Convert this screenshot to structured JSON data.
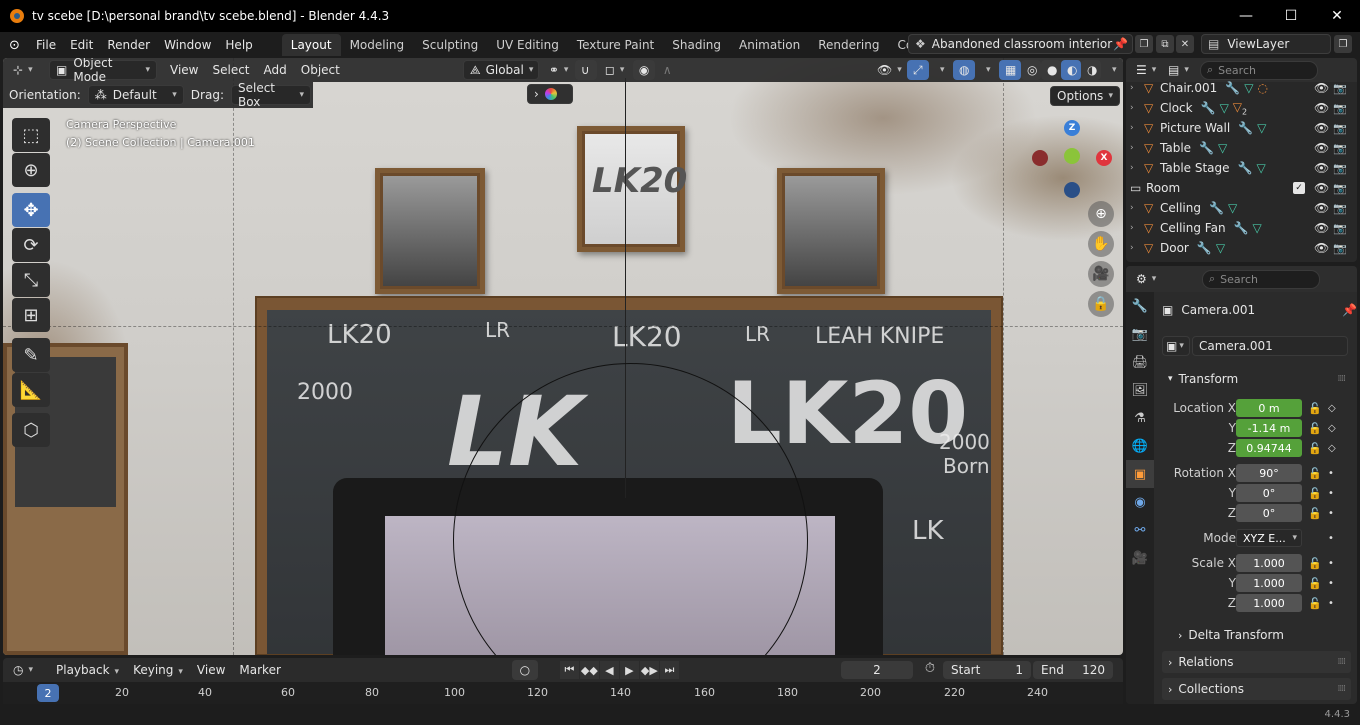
{
  "window": {
    "title": "tv scebe [D:\\personal brand\\tv scebe.blend] - Blender 4.4.3",
    "minimize": "—",
    "maximize": "☐",
    "close": "✕"
  },
  "menus": [
    "File",
    "Edit",
    "Render",
    "Window",
    "Help"
  ],
  "workspaces": [
    "Layout",
    "Modeling",
    "Sculpting",
    "UV Editing",
    "Texture Paint",
    "Shading",
    "Animation",
    "Rendering",
    "Compos"
  ],
  "scene_name": "Abandoned classroom interior",
  "view_layer": "ViewLayer",
  "viewport": {
    "mode": "Object Mode",
    "menus": [
      "View",
      "Select",
      "Add",
      "Object"
    ],
    "transform_orientation": "Global",
    "orientation_label": "Orientation:",
    "orientation_value": "Default",
    "drag_label": "Drag:",
    "drag_value": "Select Box",
    "options": "Options",
    "overlay_line1": "Camera Perspective",
    "overlay_line2": "(2) Scene Collection | Camera.001",
    "gizmo": {
      "z": "Z",
      "x": "X",
      "x_color": "#e0353d",
      "y_color": "#8bc43a",
      "z_color": "#3a7fd8"
    }
  },
  "chalkboard": {
    "lk20_top": "LK20",
    "lr": "LR",
    "leah_knipe": "LEAH KNIPE",
    "big_lk": "LK",
    "big_lk20": "LK20",
    "year": "2000",
    "born": "Born",
    "poster": "LK20"
  },
  "timeline": {
    "menus": [
      "Playback",
      "Keying",
      "View",
      "Marker"
    ],
    "current_frame": "2",
    "start_label": "Start",
    "start": "1",
    "end_label": "End",
    "end": "120",
    "ruler": [
      "20",
      "40",
      "60",
      "80",
      "100",
      "120",
      "140",
      "160",
      "180",
      "200",
      "220",
      "240"
    ],
    "play_icons": [
      "⏮",
      "◆◆",
      "◀",
      "▶",
      "◆▶",
      "⏭"
    ]
  },
  "outliner": {
    "search_placeholder": "Search",
    "rows": [
      {
        "name": "Chair.001",
        "type": "object"
      },
      {
        "name": "Clock",
        "type": "object",
        "badge": "2"
      },
      {
        "name": "Picture Wall",
        "type": "object"
      },
      {
        "name": "Table",
        "type": "object"
      },
      {
        "name": "Table Stage",
        "type": "object"
      },
      {
        "name": "Room",
        "type": "collection"
      },
      {
        "name": "Celling",
        "type": "object"
      },
      {
        "name": "Celling Fan",
        "type": "object"
      },
      {
        "name": "Door",
        "type": "object"
      }
    ]
  },
  "properties": {
    "search_placeholder": "Search",
    "object_name": "Camera.001",
    "data_name": "Camera.001",
    "transform_title": "Transform",
    "location_label": "Location X",
    "location": {
      "x": "0 m",
      "y": "-1.14 m",
      "z": "0.94744"
    },
    "rotation_label": "Rotation X",
    "rotation": {
      "x": "90°",
      "y": "0°",
      "z": "0°"
    },
    "mode_label": "Mode",
    "mode_value": "XYZ E...",
    "scale_label": "Scale X",
    "scale": {
      "x": "1.000",
      "y": "1.000",
      "z": "1.000"
    },
    "axis_y": "Y",
    "axis_z": "Z",
    "delta_transform": "Delta Transform",
    "relations": "Relations",
    "collections": "Collections"
  },
  "version": "4.4.3",
  "colors": {
    "accent": "#4772b3",
    "animated": "#55a13a",
    "object_orange": "#e8893a",
    "mesh_green": "#48c7a6"
  }
}
